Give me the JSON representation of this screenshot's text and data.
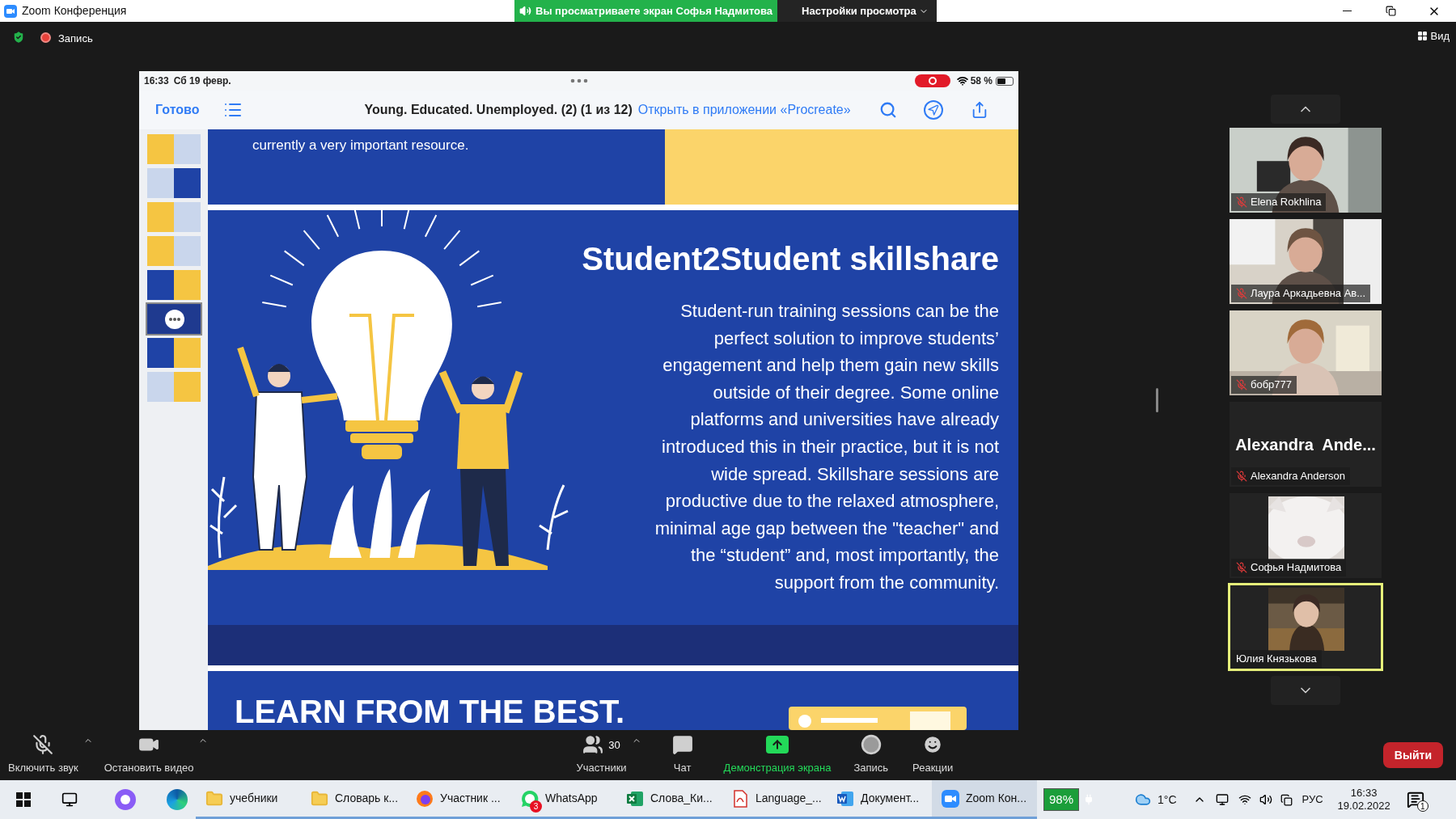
{
  "window": {
    "title": "Zoom Конференция"
  },
  "sharing_banner": {
    "text": "Вы просматриваете экран Софья Надмитова",
    "view_options": "Настройки просмотра"
  },
  "top_bar": {
    "recording": "Запись",
    "view": "Вид"
  },
  "shared_screen": {
    "status_bar": {
      "time": "16:33",
      "date": "Сб 19 февр.",
      "battery": "58 %"
    },
    "toolbar": {
      "done": "Готово",
      "document_title": "Young. Educated. Unemployed. (2) (1 из 12)",
      "open_in": "Открыть в приложении «Procreate»"
    },
    "thumbnails": [
      {
        "selected": false
      },
      {
        "selected": false
      },
      {
        "selected": false
      },
      {
        "selected": false
      },
      {
        "selected": false
      },
      {
        "selected": true
      },
      {
        "selected": false
      },
      {
        "selected": false
      }
    ],
    "slides": [
      {
        "kind": "partial_top",
        "text": "currently a very important resource."
      },
      {
        "kind": "feature",
        "title": "Student2Student skillshare",
        "body": "Student-run training sessions can be the perfect solution to improve students’ engagement and help them gain new skills outside of their degree. Some online platforms and universities have already introduced this in their practice, but it is not wide spread. Skillshare sessions are productive due to the relaxed atmosphere, minimal age gap between the \"teacher\" and the “student” and, most importantly, the support from the community."
      },
      {
        "kind": "partial_bottom",
        "title": "LEARN FROM THE BEST."
      }
    ]
  },
  "participants": [
    {
      "kind": "video",
      "name": "Elena Rokhlina",
      "muted": true,
      "highlighted": false
    },
    {
      "kind": "video",
      "name": "Лаура Аркадьевна Ав...",
      "muted": true,
      "highlighted": false
    },
    {
      "kind": "video",
      "name": "бобр777",
      "muted": true,
      "highlighted": false
    },
    {
      "kind": "name_only",
      "display_name": "Alexandra  Ande...",
      "name": "Alexandra Anderson",
      "muted": true,
      "highlighted": false
    },
    {
      "kind": "avatar",
      "name": "Софья Надмитова",
      "muted": true,
      "highlighted": false
    },
    {
      "kind": "avatar",
      "name": "Юлия Князькова",
      "muted": false,
      "highlighted": true
    }
  ],
  "toolbar": {
    "buttons": [
      {
        "kind": "mic",
        "label": "Включить звук",
        "active": false
      },
      {
        "kind": "video",
        "label": "Остановить видео",
        "active": false
      },
      {
        "kind": "participants",
        "label": "Участники",
        "count": "30",
        "active": false
      },
      {
        "kind": "chat",
        "label": "Чат",
        "active": false
      },
      {
        "kind": "share",
        "label": "Демонстрация экрана",
        "active": true
      },
      {
        "kind": "record",
        "label": "Запись",
        "active": false
      },
      {
        "kind": "reactions",
        "label": "Реакции",
        "active": false
      }
    ],
    "leave": "Выйти"
  },
  "taskbar": {
    "apps": [
      {
        "kind": "folder",
        "label": "учебники",
        "active": false
      },
      {
        "kind": "folder",
        "label": "Словарь к...",
        "active": false
      },
      {
        "kind": "browser",
        "label": "Участник ...",
        "active": false
      },
      {
        "kind": "chat",
        "label": "WhatsApp",
        "badge": "3",
        "active": false
      },
      {
        "kind": "sheet",
        "label": "Слова_Ки...",
        "active": false
      },
      {
        "kind": "pdf",
        "label": "Language_...",
        "active": false
      },
      {
        "kind": "doc",
        "label": "Документ...",
        "active": false
      },
      {
        "kind": "zoom",
        "label": "Zoom Кон...",
        "active": true
      }
    ],
    "battery": "98%",
    "temperature": "1°C",
    "language": "РУС",
    "time": "16:33",
    "date": "19.02.2022",
    "notifications": "1"
  }
}
